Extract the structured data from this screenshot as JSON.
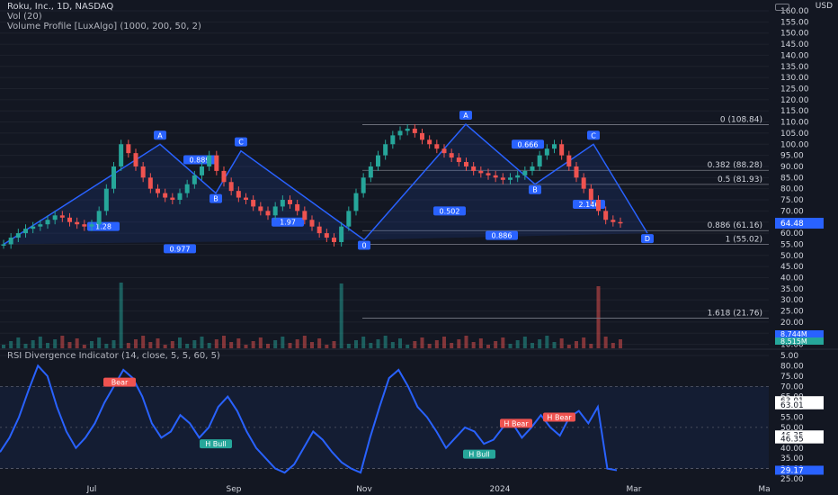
{
  "header": {
    "title": "Roku, Inc., 1D, NASDAQ",
    "vol": "Vol (20)",
    "vp": "Volume Profile [LuxAlgo] (1000, 200, 50, 2)",
    "rsi": "RSI Divergence Indicator (14, close, 5, 5, 60, 5)",
    "currency": "USD"
  },
  "chart_data": {
    "type": "line",
    "price_axis": {
      "ticks": [
        "160.00",
        "155.00",
        "150.00",
        "145.00",
        "140.00",
        "135.00",
        "130.00",
        "125.00",
        "120.00",
        "115.00",
        "110.00",
        "105.00",
        "100.00",
        "95.00",
        "90.00",
        "85.00",
        "80.00",
        "75.00",
        "70.00",
        "65.00",
        "60.00",
        "55.00",
        "50.00",
        "45.00",
        "40.00",
        "35.00",
        "30.00",
        "25.00",
        "20.00",
        "15.00",
        "10.00",
        "5.00"
      ],
      "ylim": [
        5,
        160
      ],
      "last_price": "64.48"
    },
    "rsi_axis": {
      "ticks": [
        "85.00",
        "80.00",
        "75.00",
        "70.00",
        "65.00",
        "60.00",
        "55.00",
        "50.00",
        "45.00",
        "40.00",
        "35.00",
        "30.00",
        "25.00"
      ],
      "ylim": [
        25,
        85
      ],
      "labels": [
        "63.01",
        "63.01",
        "46.35",
        "46.35",
        "29.17"
      ]
    },
    "x_labels": [
      "Jul",
      "Sep",
      "Nov",
      "2024",
      "Mar",
      "Ma"
    ],
    "price": [
      55,
      58,
      60,
      62,
      63,
      64,
      66,
      68,
      67,
      65,
      64,
      63,
      64,
      70,
      80,
      90,
      100,
      96,
      90,
      85,
      80,
      78,
      76,
      75,
      78,
      82,
      86,
      90,
      95,
      88,
      83,
      79,
      76,
      75,
      72,
      70,
      68,
      72,
      75,
      73,
      70,
      66,
      63,
      60,
      58,
      56,
      63,
      70,
      78,
      85,
      90,
      95,
      100,
      104,
      106,
      107,
      105,
      102,
      100,
      98,
      96,
      94,
      92,
      90,
      88,
      87,
      86,
      85,
      84,
      85,
      86,
      88,
      90,
      95,
      98,
      100,
      95,
      90,
      85,
      80,
      75,
      70,
      66,
      65,
      64.48
    ],
    "rsi": [
      38,
      45,
      55,
      68,
      80,
      75,
      60,
      48,
      40,
      45,
      52,
      62,
      70,
      78,
      74,
      65,
      52,
      45,
      48,
      56,
      52,
      45,
      50,
      60,
      65,
      58,
      48,
      40,
      35,
      30,
      28,
      32,
      40,
      48,
      44,
      38,
      33,
      30,
      28,
      45,
      60,
      74,
      78,
      70,
      60,
      55,
      48,
      40,
      45,
      50,
      48,
      42,
      44,
      50,
      52,
      45,
      50,
      56,
      50,
      46,
      55,
      58,
      52,
      60,
      30,
      29.17
    ],
    "fib_levels": [
      {
        "label": "0 (108.84)",
        "value": 108.84
      },
      {
        "label": "0.382 (88.28)",
        "value": 88.28
      },
      {
        "label": "0.5 (81.93)",
        "value": 81.93
      },
      {
        "label": "0.886 (61.16)",
        "value": 61.16
      },
      {
        "label": "1 (55.02)",
        "value": 55.02
      },
      {
        "label": "1.618 (21.76)",
        "value": 21.76
      }
    ],
    "pattern_labels": [
      "A",
      "B",
      "C",
      "A",
      "B",
      "C",
      "D",
      "0"
    ],
    "ratio_labels": [
      "0.889",
      "1.28",
      "1.97",
      "0.977",
      "0.666",
      "0.502",
      "2.146",
      "0.886"
    ],
    "volume_labels": [
      "8.744M",
      "8.515M"
    ],
    "divergence_labels": [
      "Bear",
      "H Bull",
      "H Bull",
      "H Bear",
      "H Bear"
    ]
  },
  "colors": {
    "background": "#131722",
    "up": "#26a69a",
    "down": "#ef5350",
    "pattern": "#2962ff",
    "rsi_line": "#2962ff",
    "text": "#d1d4dc"
  }
}
